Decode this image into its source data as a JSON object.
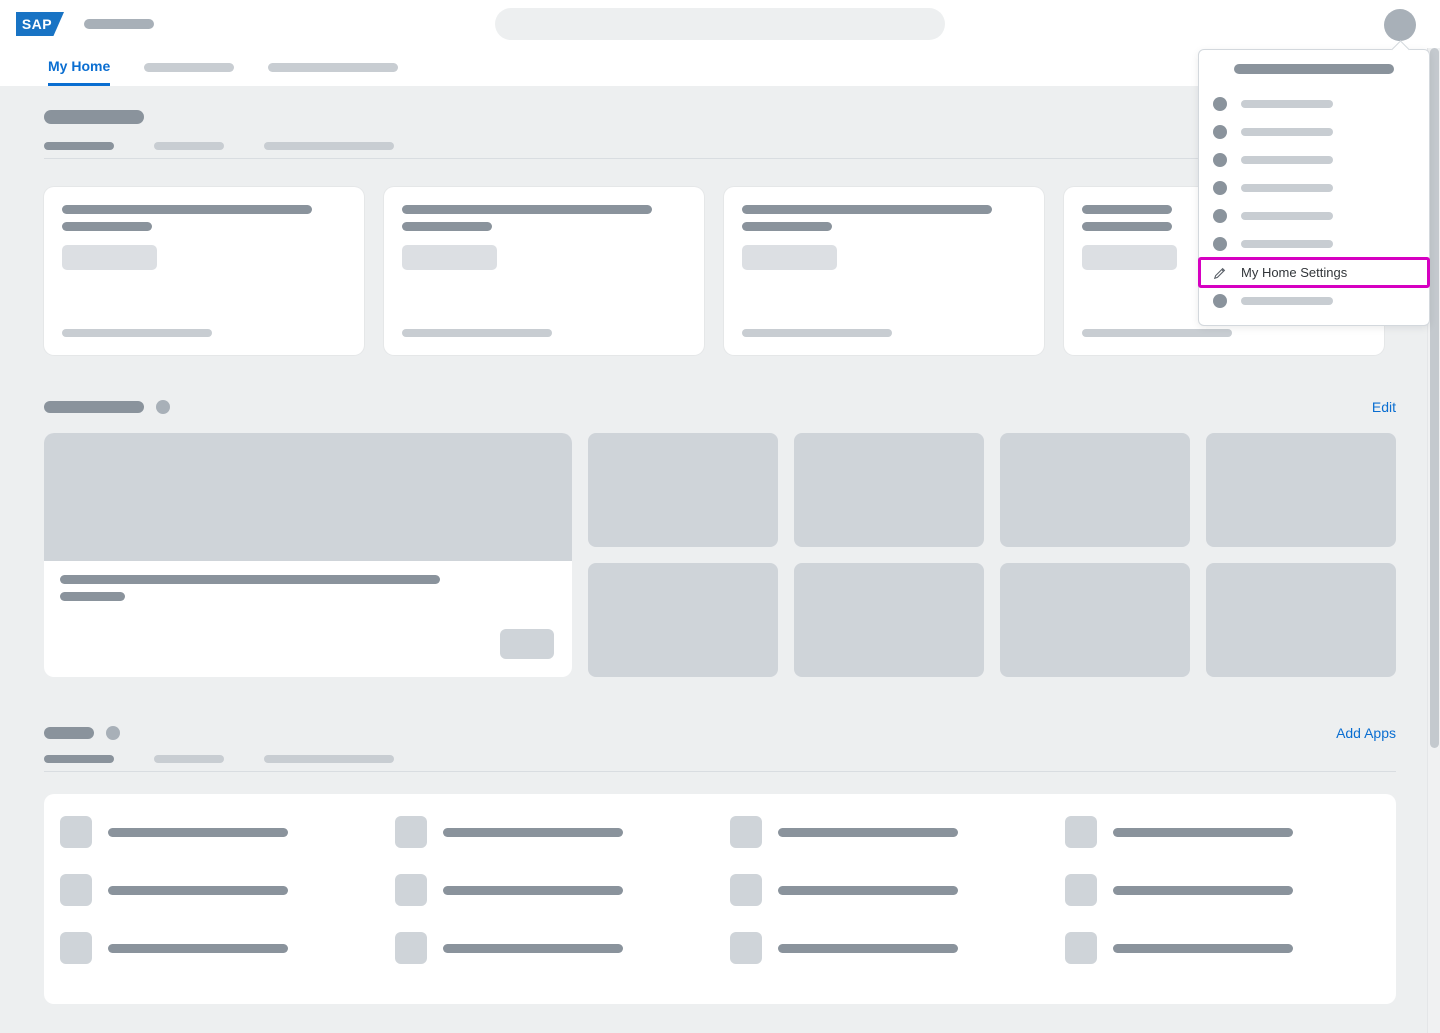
{
  "logo_text": "SAP",
  "main_tabs": [
    {
      "label": "My Home",
      "active": true
    }
  ],
  "section2": {
    "edit_label": "Edit"
  },
  "section3": {
    "add_label": "Add Apps"
  },
  "user_menu": {
    "highlighted_item_label": "My Home Settings"
  }
}
